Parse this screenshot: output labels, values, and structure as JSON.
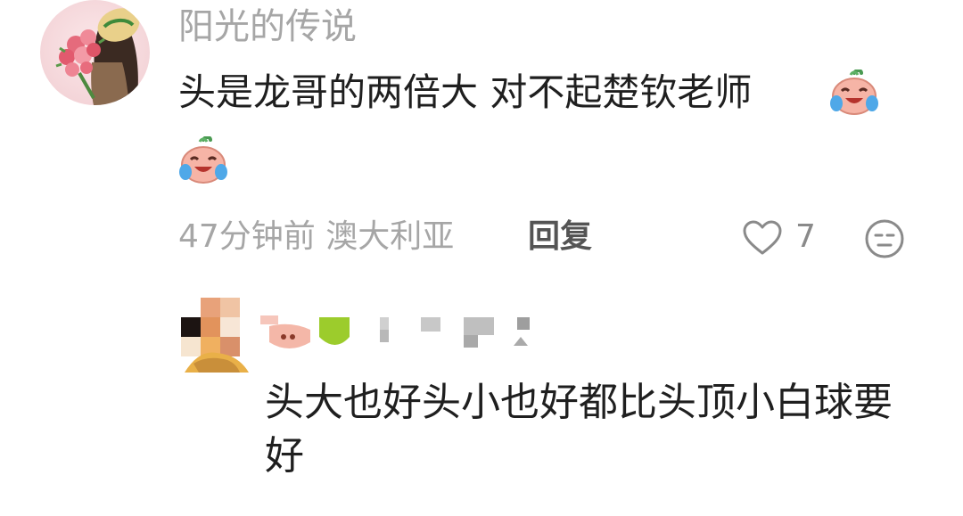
{
  "comment": {
    "username": "阳光的传说",
    "text": "头是龙哥的两倍大 对不起楚钦老师",
    "emoji": "crying-laughing-emoji",
    "time_location": "47分钟前 澳大利亚",
    "reply_label": "回复",
    "like_count": "7"
  },
  "reply": {
    "text": "头大也好头小也好都比头顶小白球要好"
  },
  "colors": {
    "text": "#1f1f1f",
    "muted": "#a6a6a6",
    "reply_button": "#545454",
    "background": "#ffffff"
  }
}
